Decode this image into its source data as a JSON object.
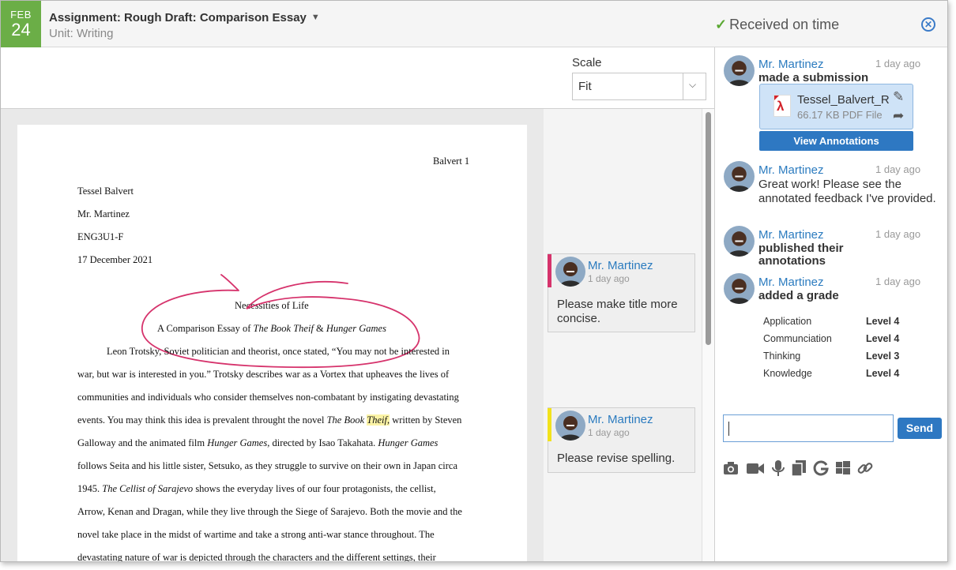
{
  "header": {
    "date_month": "FEB",
    "date_day": "24",
    "assignment_title": "Assignment: Rough Draft: Comparison Essay",
    "unit": "Unit: Writing",
    "status": "Received on time"
  },
  "toolbar": {
    "scale_label": "Scale",
    "scale_value": "Fit"
  },
  "document": {
    "page_header": "Balvert 1",
    "author": "Tessel Balvert",
    "teacher": "Mr. Martinez",
    "course": "ENG3U1-F",
    "date": "17 December 2021",
    "title": "Necessities of Life",
    "subtitle_prefix": "A Comparison Essay of ",
    "subtitle_book1": "The Book Theif",
    "subtitle_amp": " & ",
    "subtitle_book2": "Hunger Games",
    "line1": "Leon Trotsky, Soviet politician and theorist, once stated, “You may not be interested in",
    "line2": "war, but war is interested in you.” Trotsky describes war as a Vortex that upheaves the lives of",
    "line3": "communities and individuals who consider themselves non-combatant by instigating devastating",
    "line4_a": "events. You may think this idea is prevalent throught the novel ",
    "line4_b": "The Book ",
    "line4_c": "Theif,",
    "line4_d": " written by Steven",
    "line5_a": "Galloway and the animated film ",
    "line5_b": "Hunger Games,",
    "line5_c": " directed by Isao Takahata. ",
    "line5_d": "Hunger Games",
    "line6": "follows Seita and his little sister, Setsuko, as they struggle to survive on their own in Japan circa",
    "line7_a": "1945. ",
    "line7_b": "The Cellist of Sarajevo",
    "line7_c": " shows the everyday lives of our four protagonists, the cellist,",
    "line8": "Arrow, Kenan and Dragan, while they live through the Siege of Sarajevo. Both the movie and the",
    "line9": "novel take place in the midst of wartime and take a strong anti-war stance throughout. The",
    "line10": "devastating nature of war is depicted through the characters and the different settings, their"
  },
  "comments": [
    {
      "author": "Mr. Martinez",
      "time": "1 day ago",
      "text": "Please make title more concise.",
      "accent": "#d6336c"
    },
    {
      "author": "Mr. Martinez",
      "time": "1 day ago",
      "text": "Please revise spelling.",
      "accent": "#f2e21c"
    }
  ],
  "activity": {
    "items": [
      {
        "name": "Mr. Martinez",
        "time": "1 day ago",
        "action": "made a submission"
      },
      {
        "name": "Mr. Martinez",
        "time": "1 day ago",
        "message": "Great work! Please see the annotated feedback I've provided."
      },
      {
        "name": "Mr. Martinez",
        "time": "1 day ago",
        "action": "published their annotations"
      },
      {
        "name": "Mr. Martinez",
        "time": "1 day ago",
        "action": "added a grade"
      }
    ],
    "file": {
      "name": "Tessel_Balvert_R",
      "meta": "66.17 KB PDF File",
      "view_button": "View Annotations"
    },
    "grades": [
      {
        "category": "Application",
        "level": "Level 4"
      },
      {
        "category": "Communciation",
        "level": "Level 4"
      },
      {
        "category": "Thinking",
        "level": "Level 3"
      },
      {
        "category": "Knowledge",
        "level": "Level 4"
      }
    ],
    "reply": {
      "value": "",
      "send_label": "Send"
    },
    "tools": [
      "camera-icon",
      "video-icon",
      "microphone-icon",
      "documents-icon",
      "google-icon",
      "windows-icon",
      "link-icon"
    ]
  },
  "colors": {
    "accent_blue": "#2e78c2",
    "date_green": "#6bae47",
    "check_green": "#5aa832",
    "annotation_pink": "#d6336c",
    "highlight_yellow": "#fbf3a6"
  }
}
